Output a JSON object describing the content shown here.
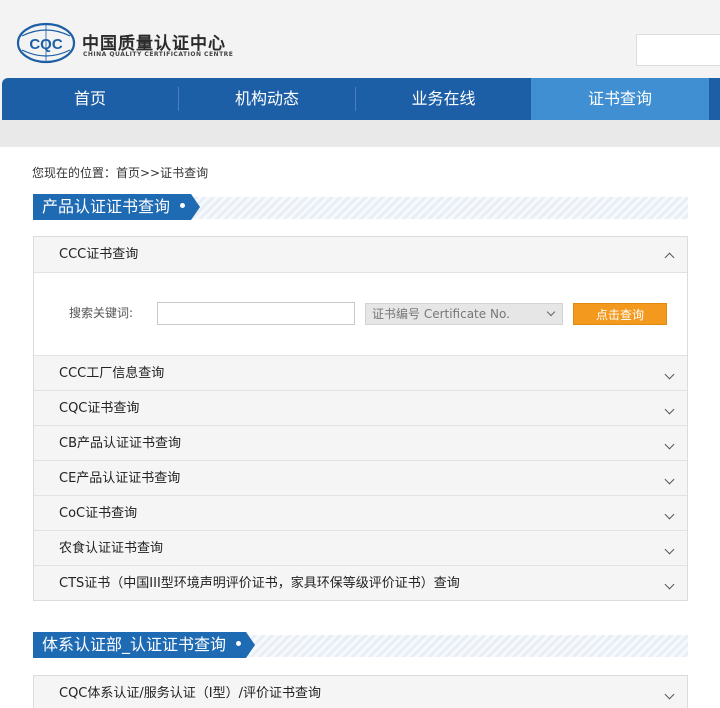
{
  "header": {
    "org_name_cn": "中国质量认证中心",
    "org_name_en": "CHINA QUALITY CERTIFICATION CENTRE",
    "logo_text": "CQC"
  },
  "nav": {
    "items": [
      {
        "label": "首页",
        "active": false
      },
      {
        "label": "机构动态",
        "active": false
      },
      {
        "label": "业务在线",
        "active": false
      },
      {
        "label": "证书查询",
        "active": true
      }
    ]
  },
  "breadcrumb": "您现在的位置：首页>>证书查询",
  "sections": [
    {
      "title": "产品认证证书查询",
      "items": [
        {
          "label": "CCC证书查询",
          "expanded": true
        },
        {
          "label": "CCC工厂信息查询",
          "expanded": false
        },
        {
          "label": "CQC证书查询",
          "expanded": false
        },
        {
          "label": "CB产品认证证书查询",
          "expanded": false
        },
        {
          "label": "CE产品认证证书查询",
          "expanded": false
        },
        {
          "label": "CoC证书查询",
          "expanded": false
        },
        {
          "label": "农食认证证书查询",
          "expanded": false
        },
        {
          "label": "CTS证书（中国III型环境声明评价证书，家具环保等级评价证书）查询",
          "expanded": false
        }
      ]
    },
    {
      "title": "体系认证部_认证证书查询",
      "items": [
        {
          "label": "CQC体系认证/服务认证（I型）/评价证书查询",
          "expanded": false
        }
      ]
    }
  ],
  "search": {
    "label": "搜索关键词:",
    "input_value": "",
    "input_placeholder": "",
    "select_value": "证书编号 Certificate No.",
    "button_label": "点击查询"
  },
  "colors": {
    "nav_bg": "#1d5fa6",
    "nav_active": "#3f8fd2",
    "section_tab": "#1e6ab3",
    "search_button": "#f39a1e"
  }
}
